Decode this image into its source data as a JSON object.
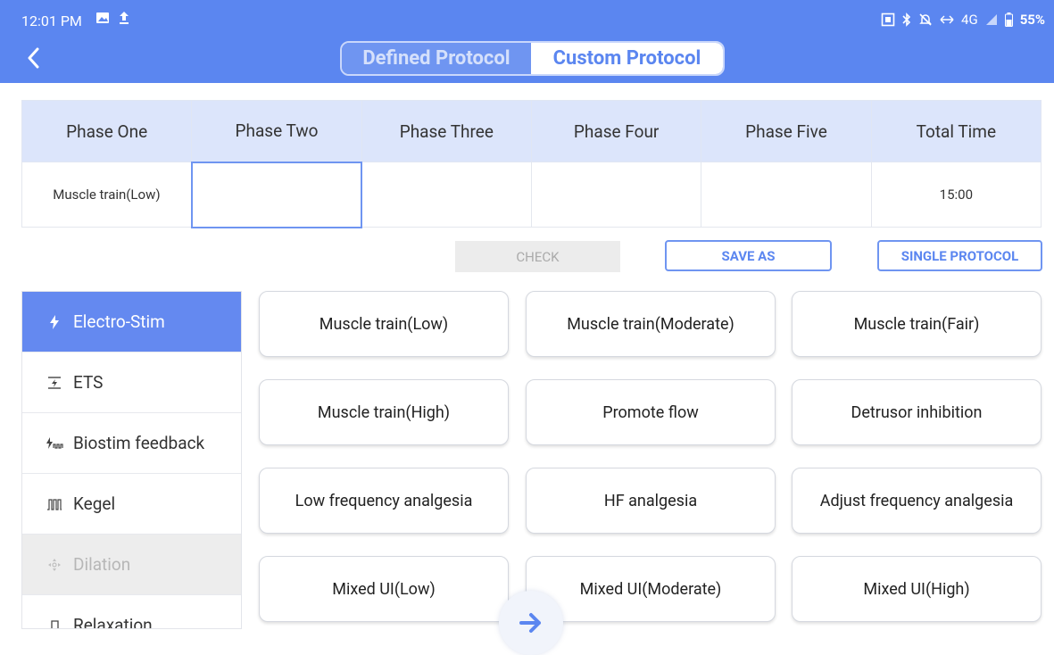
{
  "status_bar": {
    "time": "12:01 PM",
    "network": "4G",
    "battery": "55%",
    "icons_left": [
      "image-icon",
      "upload-icon"
    ],
    "icons_right": [
      "screenshot-icon",
      "bluetooth-icon",
      "mute-icon",
      "data-arrows-icon",
      "signal-icon",
      "battery-icon"
    ]
  },
  "header": {
    "tabs": [
      {
        "label": "Defined Protocol",
        "selected": false
      },
      {
        "label": "Custom Protocol",
        "selected": true
      }
    ]
  },
  "phase_table": {
    "headers": [
      "Phase One",
      "Phase Two",
      "Phase Three",
      "Phase Four",
      "Phase Five",
      "Total Time"
    ],
    "row": [
      "Muscle train(Low)",
      "",
      "",
      "",
      "",
      "15:00"
    ]
  },
  "actions": {
    "check": "CHECK",
    "save_as": "SAVE AS",
    "single_protocol": "SINGLE PROTOCOL"
  },
  "sidebar": {
    "items": [
      {
        "label": "Electro-Stim",
        "icon": "bolt-icon",
        "state": "active"
      },
      {
        "label": "ETS",
        "icon": "ets-icon",
        "state": "normal"
      },
      {
        "label": "Biostim feedback",
        "icon": "biostim-icon",
        "state": "normal"
      },
      {
        "label": "Kegel",
        "icon": "kegel-icon",
        "state": "normal"
      },
      {
        "label": "Dilation",
        "icon": "dilation-icon",
        "state": "disabled"
      },
      {
        "label": "Relaxation",
        "icon": "relaxation-icon",
        "state": "normal"
      }
    ]
  },
  "protocols": [
    "Muscle train(Low)",
    "Muscle train(Moderate)",
    "Muscle train(Fair)",
    "Muscle train(High)",
    "Promote flow",
    "Detrusor inhibition",
    "Low frequency analgesia",
    "HF analgesia",
    "Adjust frequency analgesia",
    "Mixed UI(Low)",
    "Mixed UI(Moderate)",
    "Mixed UI(High)"
  ],
  "colors": {
    "primary": "#5b86f0",
    "header_cell": "#dce5fb",
    "disabled_bg": "#ededed"
  }
}
